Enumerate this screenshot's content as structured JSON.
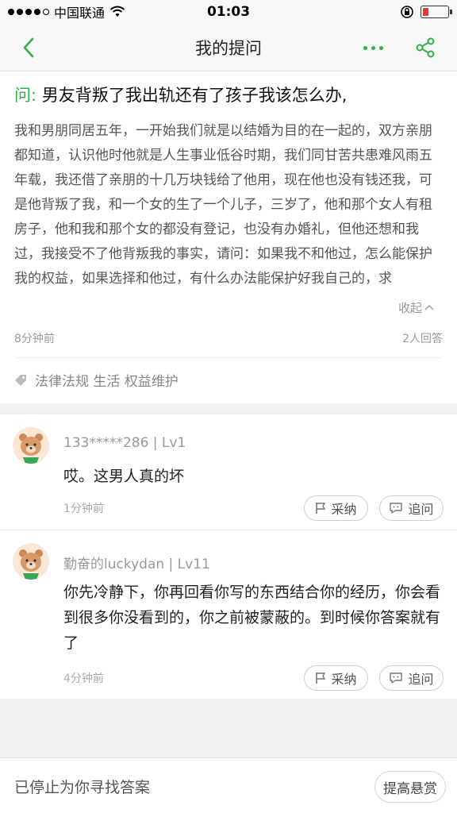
{
  "status_bar": {
    "carrier": "中国联通",
    "time": "01:03",
    "battery_level": 0.2
  },
  "nav": {
    "title": "我的提问"
  },
  "question": {
    "prefix": "问:",
    "title": "男友背叛了我出轨还有了孩子我该怎么办,",
    "body": "我和男朋同居五年，一开始我们就是以结婚为目的在一起的，双方亲朋都知道，认识他时他就是人生事业低谷时期，我们同甘苦共患难风雨五年载，我还借了亲朋的十几万块钱给了他用，现在他也没有钱还我，可是他背叛了我，和一个女的生了一个儿子，三岁了，他和那个女人有租房子，他和我和那个女的都没有登记，也没有办婚礼，但他还想和我过，我接受不了他背叛我的事实，请问：如果我不和他过，怎么能保护我的权益，如果选择和他过，有什么办法能保护好我自己的，求",
    "collapse_label": "收起",
    "time": "8分钟前",
    "answer_count": "2人回答",
    "tags": "法律法规 生活 权益维护"
  },
  "answers": [
    {
      "user": "133*****286 | Lv1",
      "text": "哎。这男人真的坏",
      "time": "1分钟前",
      "accept_label": "采纳",
      "followup_label": "追问"
    },
    {
      "user": "勤奋的luckydan | Lv11",
      "text": "你先冷静下，你再回看你写的东西结合你的经历，你会看到很多你没看到的，你之前被蒙蔽的。到时候你答案就有了",
      "time": "4分钟前",
      "accept_label": "采纳",
      "followup_label": "追问"
    }
  ],
  "bottom": {
    "status": "已停止为你寻找答案",
    "reward_label": "提高悬赏"
  },
  "colors": {
    "accent": "#2fb04a",
    "battery_low": "#e53935"
  }
}
